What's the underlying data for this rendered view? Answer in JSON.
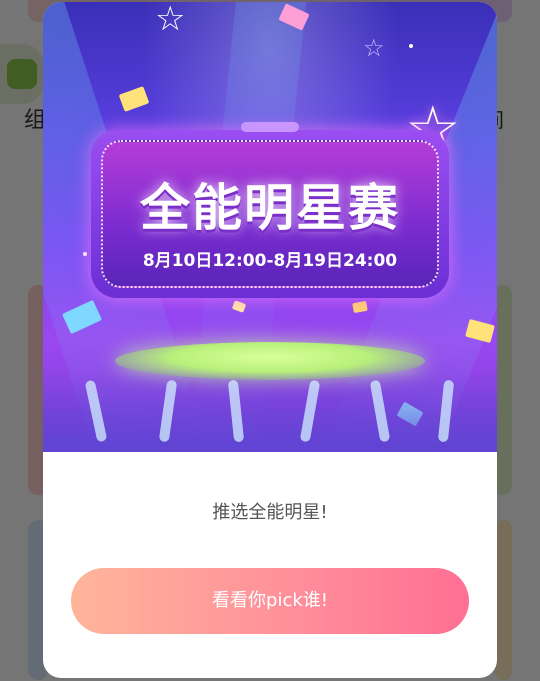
{
  "background": {
    "left_label": "组",
    "right_label": "间"
  },
  "popup": {
    "banner": {
      "title": "全能明星赛",
      "date_range": "8月10日12:00-8月19日24:00"
    },
    "subtitle": "推选全能明星!",
    "button_label": "看看你pick谁!"
  },
  "colors": {
    "button_start": "#ffb59a",
    "button_end": "#ff6f93",
    "banner_purple": "#7d3ff0"
  }
}
